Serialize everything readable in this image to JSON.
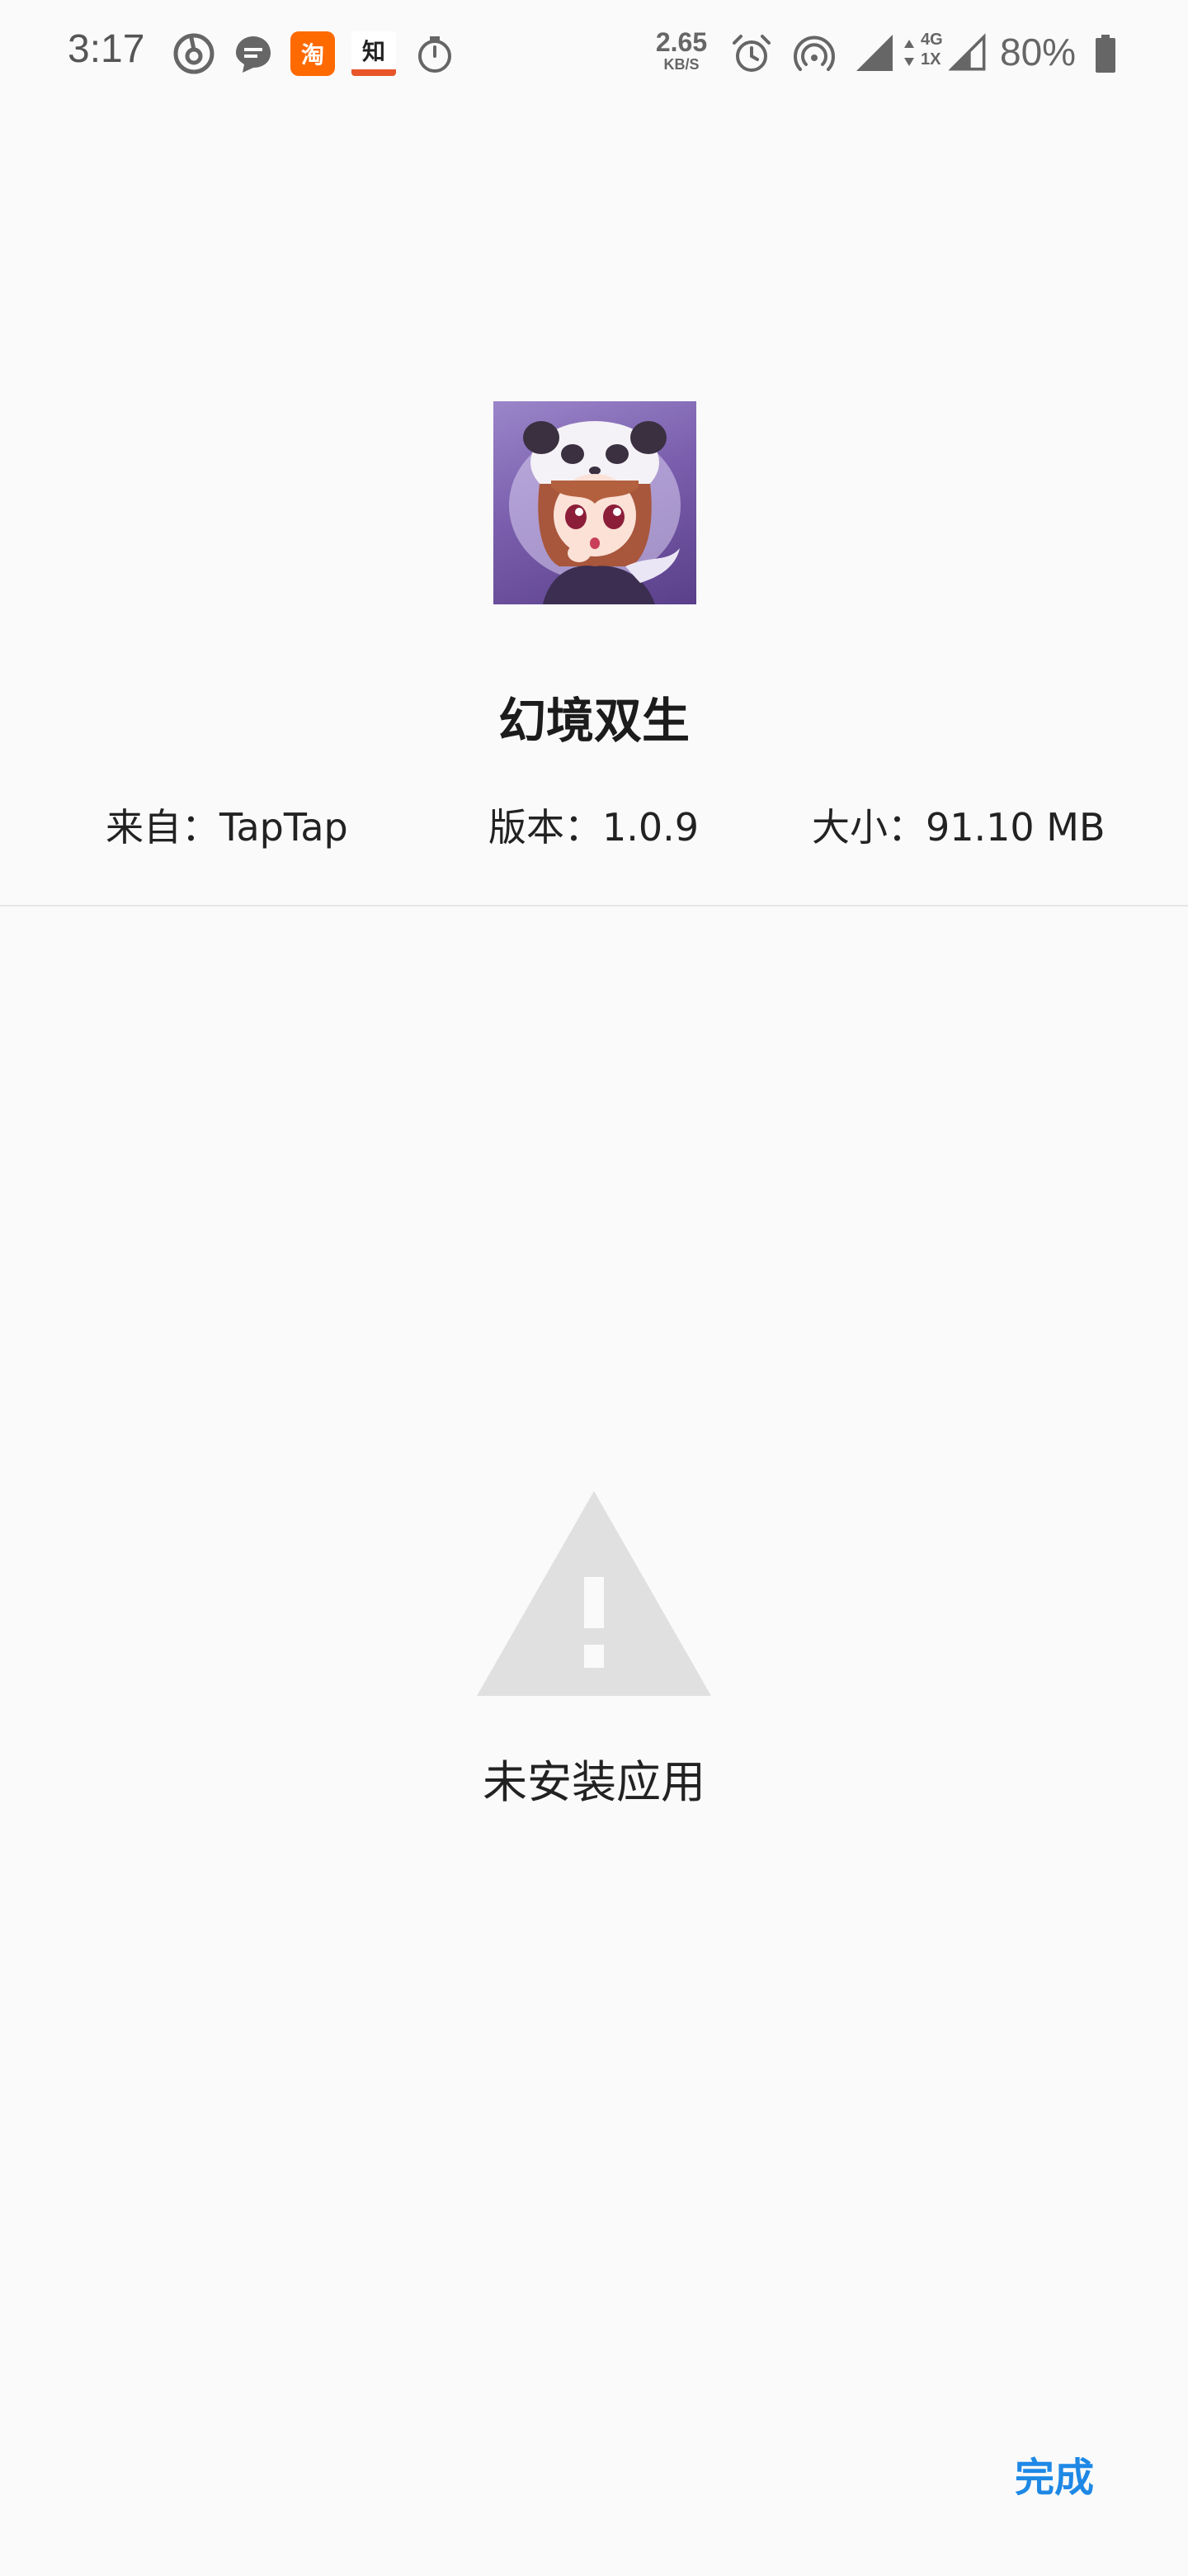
{
  "status_bar": {
    "time": "3:17",
    "notification_icons": [
      "netease-music-icon",
      "message-bubble-icon",
      "taobao-icon",
      "zhihu-icon",
      "stopwatch-icon"
    ],
    "taobao_label": "淘",
    "zhihu_label": "知",
    "net_speed_value": "2.65",
    "net_speed_unit": "KB/S",
    "network_type": "4G",
    "network_sub": "1X",
    "battery": "80%",
    "colors": {
      "icon": "#666666",
      "taobao": "#ff6a00",
      "zhihu_accent": "#e8552b"
    }
  },
  "app": {
    "name": "幻境双生",
    "icon": "app-icon-panda-girl",
    "source": "来自：TapTap",
    "version": "版本：1.0.9",
    "size": "大小：91.10 MB"
  },
  "result": {
    "icon": "warning-icon",
    "message": "未安装应用",
    "icon_color": "#e0e0e0"
  },
  "actions": {
    "done_label": "完成",
    "accent_color": "#1e88e5"
  }
}
